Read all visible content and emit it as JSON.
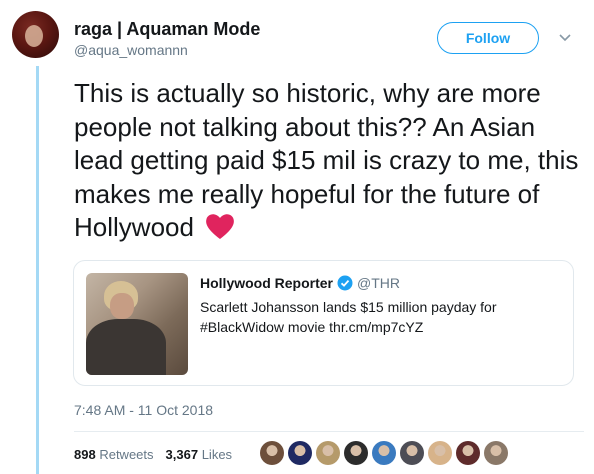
{
  "user": {
    "display_name": "raga | Aquaman Mode",
    "handle": "@aqua_womannn"
  },
  "follow_label": "Follow",
  "tweet": {
    "text": "This is actually so historic, why are more people not talking about this?? An Asian lead getting paid $15 mil is crazy to me, this makes me really hopeful for the future of Hollywood",
    "emoji": "red-heart-icon"
  },
  "quote": {
    "name": "Hollywood Reporter",
    "handle": "@THR",
    "text": "Scarlett Johansson lands $15 million payday for #BlackWidow movie thr.cm/mp7cYZ"
  },
  "timestamp": "7:48 AM - 11 Oct 2018",
  "stats": {
    "retweets_count": "898",
    "retweets_label": "Retweets",
    "likes_count": "3,367",
    "likes_label": "Likes"
  },
  "colors": {
    "accent": "#1da1f2",
    "text": "#14171a",
    "muted": "#657786",
    "heart": "#e0245e"
  },
  "likers": [
    {
      "color": "#6d4f3b"
    },
    {
      "color": "#1f2a63"
    },
    {
      "color": "#b59a6a"
    },
    {
      "color": "#2c2c2c"
    },
    {
      "color": "#3a7abf"
    },
    {
      "color": "#4d4d55"
    },
    {
      "color": "#d7b38a"
    },
    {
      "color": "#5e2b2b"
    },
    {
      "color": "#8a7868"
    }
  ]
}
